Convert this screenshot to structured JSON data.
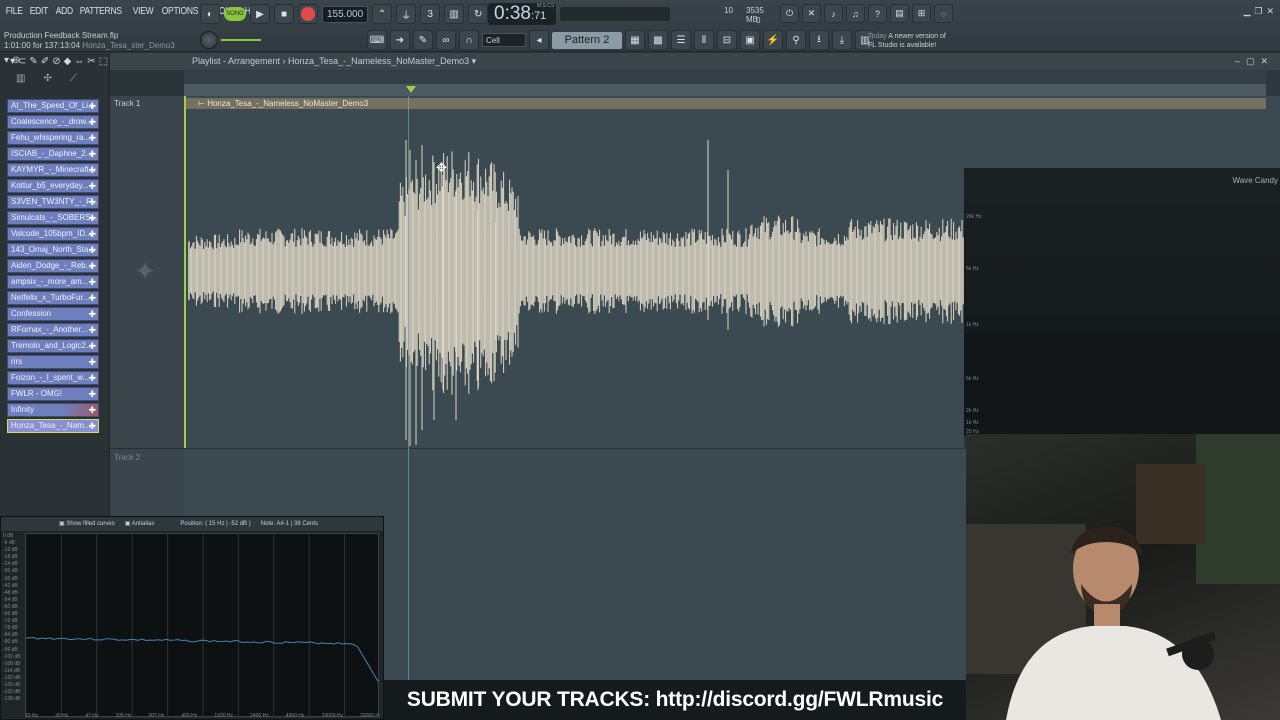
{
  "menu": [
    "FILE",
    "EDIT",
    "ADD",
    "PATTERNS",
    "VIEW",
    "OPTIONS",
    "TOOLS",
    "HELP"
  ],
  "hint": {
    "file": "Production Feedback Stream.flp",
    "time": "1:01:00 for 137:13:04",
    "track": "Honza_Tesa_ster_Demo3"
  },
  "transport": {
    "mode": "SONG",
    "tempo": "155.000",
    "time_main": "0:38",
    "time_sub": ":71",
    "time_unit": "M:S:CS"
  },
  "resources": {
    "cpu": "10",
    "memory": "3535 MB",
    "polyphony": "0"
  },
  "toolbar": {
    "snap": "Cell",
    "pattern": "Pattern 2"
  },
  "news": {
    "day": "Today",
    "message": "A newer version of",
    "message2": "FL Studio is available!"
  },
  "playlist": {
    "title": "Playlist - Arrangement",
    "arrangement": "Honza_Tesa_-_Nameless_NoMaster_Demo3",
    "track1": "Track 1",
    "track2": "Track 2",
    "clip_name": "Honza_Tesa_-_Nameless_NoMaster_Demo3"
  },
  "browser_tracks": [
    "At_The_Speed_Of_Li...",
    "Coalescence_-_drow...",
    "Fehu_whispering_ra...",
    "ISCIAB_-_Daphne_2...",
    "KAYMYR_-_Minecraft...",
    "Kottur_b5_everyday...",
    "S3VEN_TW3NTY_-_Fi...",
    "Simulcats_-_SOBERS...",
    "Valcode_105bpm_ID...",
    "143_Omaj_North_Sta...",
    "Aiden_Dodge_-_Reb...",
    "ampsix_-_more_am...",
    "Netfelix_x_TurboFur...",
    "Confession",
    "RFornax_-_Another...",
    "Tremolo_and_Logic2...",
    "rirs",
    "Foizon_-_I_spent_w...",
    "FWLR - OMG!",
    "Infinity",
    "Honza_Tesa_-_Nam..."
  ],
  "wavecandy": {
    "title": "Wave Candy",
    "labels": [
      "20k Hz",
      "5k Hz",
      "1k Hz",
      "5k Hz",
      "2k Hz",
      "1k Hz",
      "20 Hz"
    ]
  },
  "spectrum": {
    "options": [
      "Show filled curves",
      "Antialias"
    ],
    "position_label": "Position:",
    "freq": "15 Hz",
    "db": "-52 dB",
    "note_label": "Note:",
    "note": "A#-1",
    "cents": "38 Cents",
    "y_labels": [
      "0 dB",
      "-6 dB",
      "-12 dB",
      "-18 dB",
      "-24 dB",
      "-30 dB",
      "-36 dB",
      "-42 dB",
      "-48 dB",
      "-54 dB",
      "-60 dB",
      "-66 dB",
      "-72 dB",
      "-78 dB",
      "-84 dB",
      "-90 dB",
      "-96 dB",
      "-102 dB",
      "-108 dB",
      "-114 dB",
      "-120 dB",
      "-126 dB",
      "-132 dB",
      "-138 dB"
    ],
    "x_labels": [
      "15 Hz",
      "30 Hz",
      "47 Hz",
      "105 Hz",
      "207 Hz",
      "409 Hz",
      "1030 Hz",
      "2400 Hz",
      "4960 Hz",
      "10000 Hz",
      "20000 H"
    ]
  },
  "caption": "SUBMIT YOUR TRACKS: http://discord.gg/FWLRmusic",
  "colors": {
    "accent_green": "#8bc53f",
    "track_chip": "#6f7fbe",
    "waveform": "#ece3d0",
    "clip_header": "#75705f"
  }
}
